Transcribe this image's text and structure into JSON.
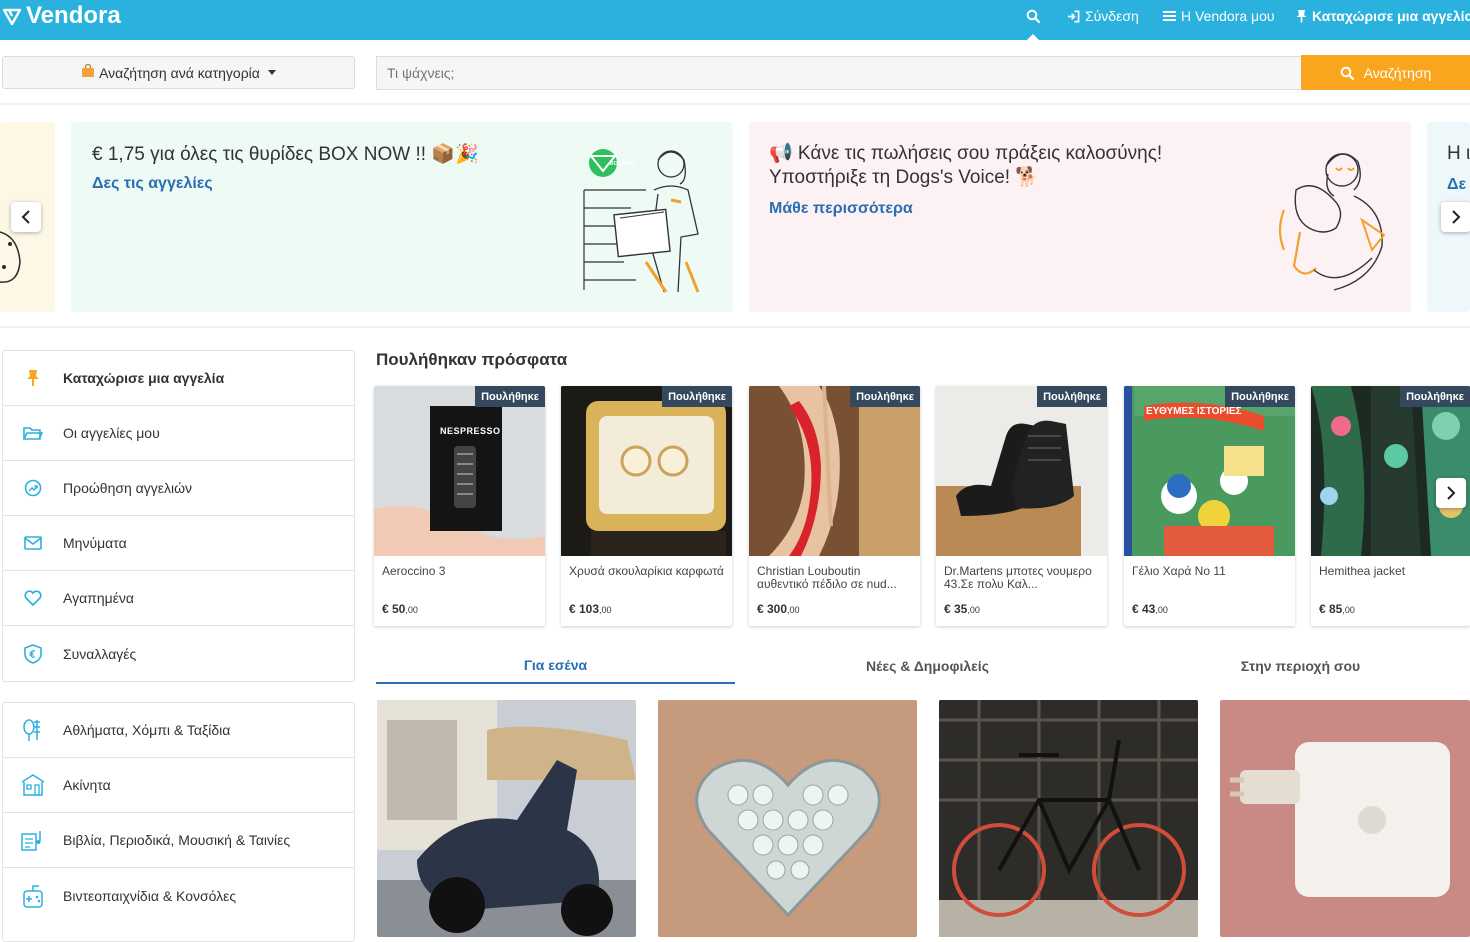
{
  "header": {
    "logo": "Vendora",
    "login_label": "Σύνδεση",
    "my_vendora_label": "Η Vendora μου",
    "post_ad_label": "Καταχώρισε μια αγγελία"
  },
  "search": {
    "category_label": "Αναζήτηση ανά κατηγορία",
    "placeholder": "Τι ψάχνεις;",
    "button_label": "Αναζήτηση"
  },
  "banners": [
    {
      "title": "€ 1,75 για όλες τις θυρίδες BOX NOW !! 📦🎉",
      "link": "Δες τις αγγελίες",
      "bg": "#eefaf4",
      "brand_badge": "BOX NOW"
    },
    {
      "title_line1": "📢 Κάνε τις πωλήσεις σου πράξεις καλοσύνης!",
      "title_line2": "Υποστήριξε τη Dogs's Voice! 🐕",
      "link": "Μάθε περισσότερα",
      "bg": "#fdf2f3"
    },
    {
      "title_partial": "Η ι",
      "link_partial": "Δε"
    }
  ],
  "sidebar_account": [
    {
      "label": "Καταχώρισε μια αγγελία",
      "icon": "pin-icon"
    },
    {
      "label": "Οι αγγελίες μου",
      "icon": "folder-icon"
    },
    {
      "label": "Προώθηση αγγελιών",
      "icon": "promote-icon"
    },
    {
      "label": "Μηνύματα",
      "icon": "mail-icon"
    },
    {
      "label": "Αγαπημένα",
      "icon": "heart-icon"
    },
    {
      "label": "Συναλλαγές",
      "icon": "euro-shield-icon"
    }
  ],
  "sidebar_categories": [
    {
      "label": "Αθλήματα, Χόμπι & Ταξίδια",
      "icon": "sports-icon"
    },
    {
      "label": "Ακίνητα",
      "icon": "building-icon"
    },
    {
      "label": "Βιβλία, Περιοδικά, Μουσική & Ταινίες",
      "icon": "books-music-icon"
    },
    {
      "label": "Βιντεοπαιχνίδια & Κονσόλες",
      "icon": "gamepad-icon"
    }
  ],
  "recently_sold": {
    "title": "Πουλήθηκαν πρόσφατα",
    "badge": "Πουλήθηκε",
    "items": [
      {
        "title": "Aeroccino 3",
        "price": "€ 50",
        "cents": ",00",
        "product_text": "NESPRESSO"
      },
      {
        "title": "Χρυσά σκουλαρίκια καρφωτά",
        "price": "€ 103",
        "cents": ",00"
      },
      {
        "title": "Christian Louboutin αυθεντικό πέδιλο σε nud...",
        "price": "€ 300",
        "cents": ",00"
      },
      {
        "title": "Dr.Martens μποτες νουμερο 43.Σε πολυ Καλ...",
        "price": "€ 35",
        "cents": ",00"
      },
      {
        "title": "Γέλιο Χαρά Νο 11",
        "price": "€ 43",
        "cents": ",00",
        "product_text": "ΕΥΘΥΜΕΣ ΙΣΤΟΡΙΕΣ"
      },
      {
        "title": "Hemithea jacket",
        "price": "€ 85",
        "cents": ",00"
      }
    ]
  },
  "tabs": [
    {
      "label": "Για εσένα",
      "active": true
    },
    {
      "label": "Νέες & Δημοφιλείς",
      "active": false
    },
    {
      "label": "Στην περιοχή σου",
      "active": false
    }
  ],
  "colors": {
    "topbar": "#2ab1de",
    "accent_orange": "#f9a61e",
    "link_blue": "#2a6eb3",
    "badge": "#34495e"
  }
}
